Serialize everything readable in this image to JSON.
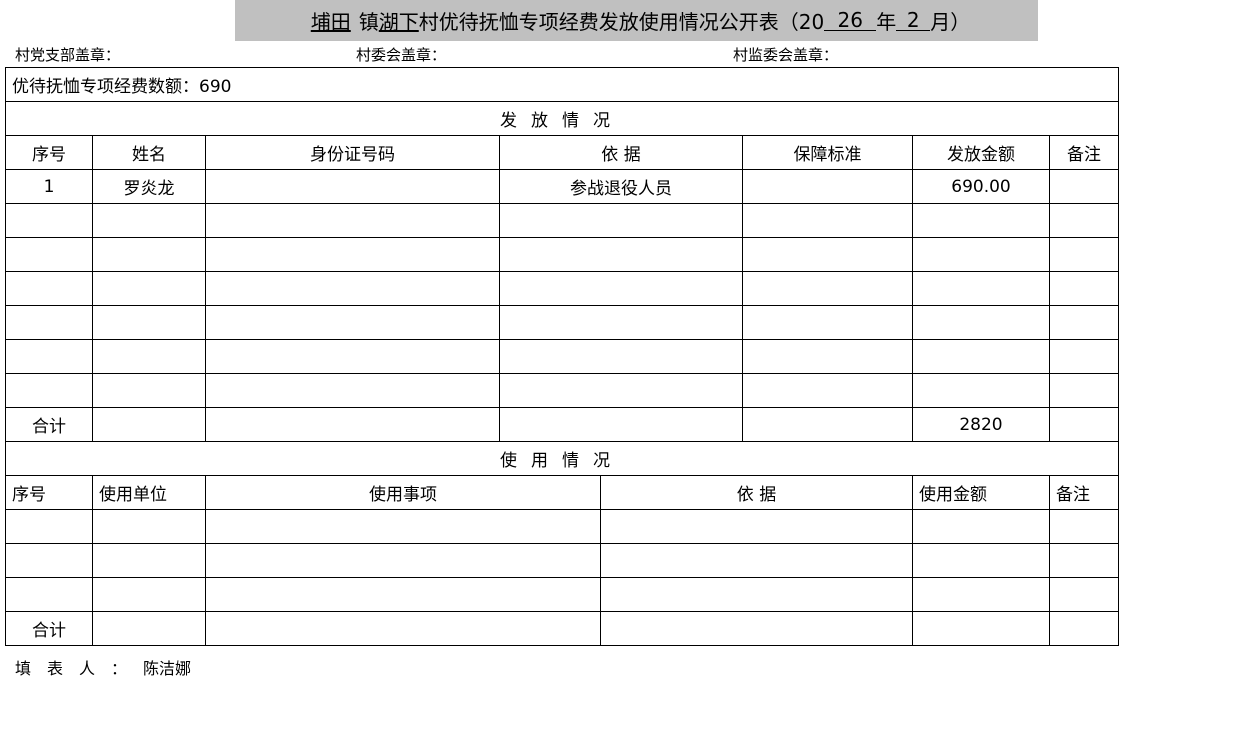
{
  "title": {
    "town": "埔田",
    "town_suffix": "镇",
    "village": "湖下",
    "main": "村优待抚恤专项经费发放使用情况公开表（20",
    "year_part": "26",
    "year_label": "年",
    "month": "2",
    "month_label": "月）"
  },
  "seals": {
    "party": "村党支部盖章：",
    "committee": "村委会盖章：",
    "supervision": "村监委会盖章："
  },
  "fund": {
    "label": "优待抚恤专项经费数额：690"
  },
  "distribution": {
    "section_title": "发放情况",
    "headers": {
      "no": "序号",
      "name": "姓名",
      "id": "身份证号码",
      "basis": "依 据",
      "standard": "保障标准",
      "amount": "发放金额",
      "remark": "备注"
    },
    "rows": [
      {
        "no": "1",
        "name": "罗炎龙",
        "id": "",
        "basis": "参战退役人员",
        "standard": "",
        "amount": "690.00",
        "remark": ""
      },
      {
        "no": "",
        "name": "",
        "id": "",
        "basis": "",
        "standard": "",
        "amount": "",
        "remark": ""
      },
      {
        "no": "",
        "name": "",
        "id": "",
        "basis": "",
        "standard": "",
        "amount": "",
        "remark": ""
      },
      {
        "no": "",
        "name": "",
        "id": "",
        "basis": "",
        "standard": "",
        "amount": "",
        "remark": ""
      },
      {
        "no": "",
        "name": "",
        "id": "",
        "basis": "",
        "standard": "",
        "amount": "",
        "remark": ""
      },
      {
        "no": "",
        "name": "",
        "id": "",
        "basis": "",
        "standard": "",
        "amount": "",
        "remark": ""
      },
      {
        "no": "",
        "name": "",
        "id": "",
        "basis": "",
        "standard": "",
        "amount": "",
        "remark": ""
      }
    ],
    "total_label": "合计",
    "total_amount": "2820"
  },
  "usage": {
    "section_title": "使用情况",
    "headers": {
      "no": "序号",
      "unit": "使用单位",
      "item": "使用事项",
      "basis": "依 据",
      "amount": "使用金额",
      "remark": "备注"
    },
    "rows": [
      {
        "no": "",
        "unit": "",
        "item": "",
        "basis": "",
        "amount": "",
        "remark": ""
      },
      {
        "no": "",
        "unit": "",
        "item": "",
        "basis": "",
        "amount": "",
        "remark": ""
      },
      {
        "no": "",
        "unit": "",
        "item": "",
        "basis": "",
        "amount": "",
        "remark": ""
      }
    ],
    "total_label": "合计"
  },
  "filler": {
    "label": "填表人：",
    "name": "陈洁娜"
  }
}
